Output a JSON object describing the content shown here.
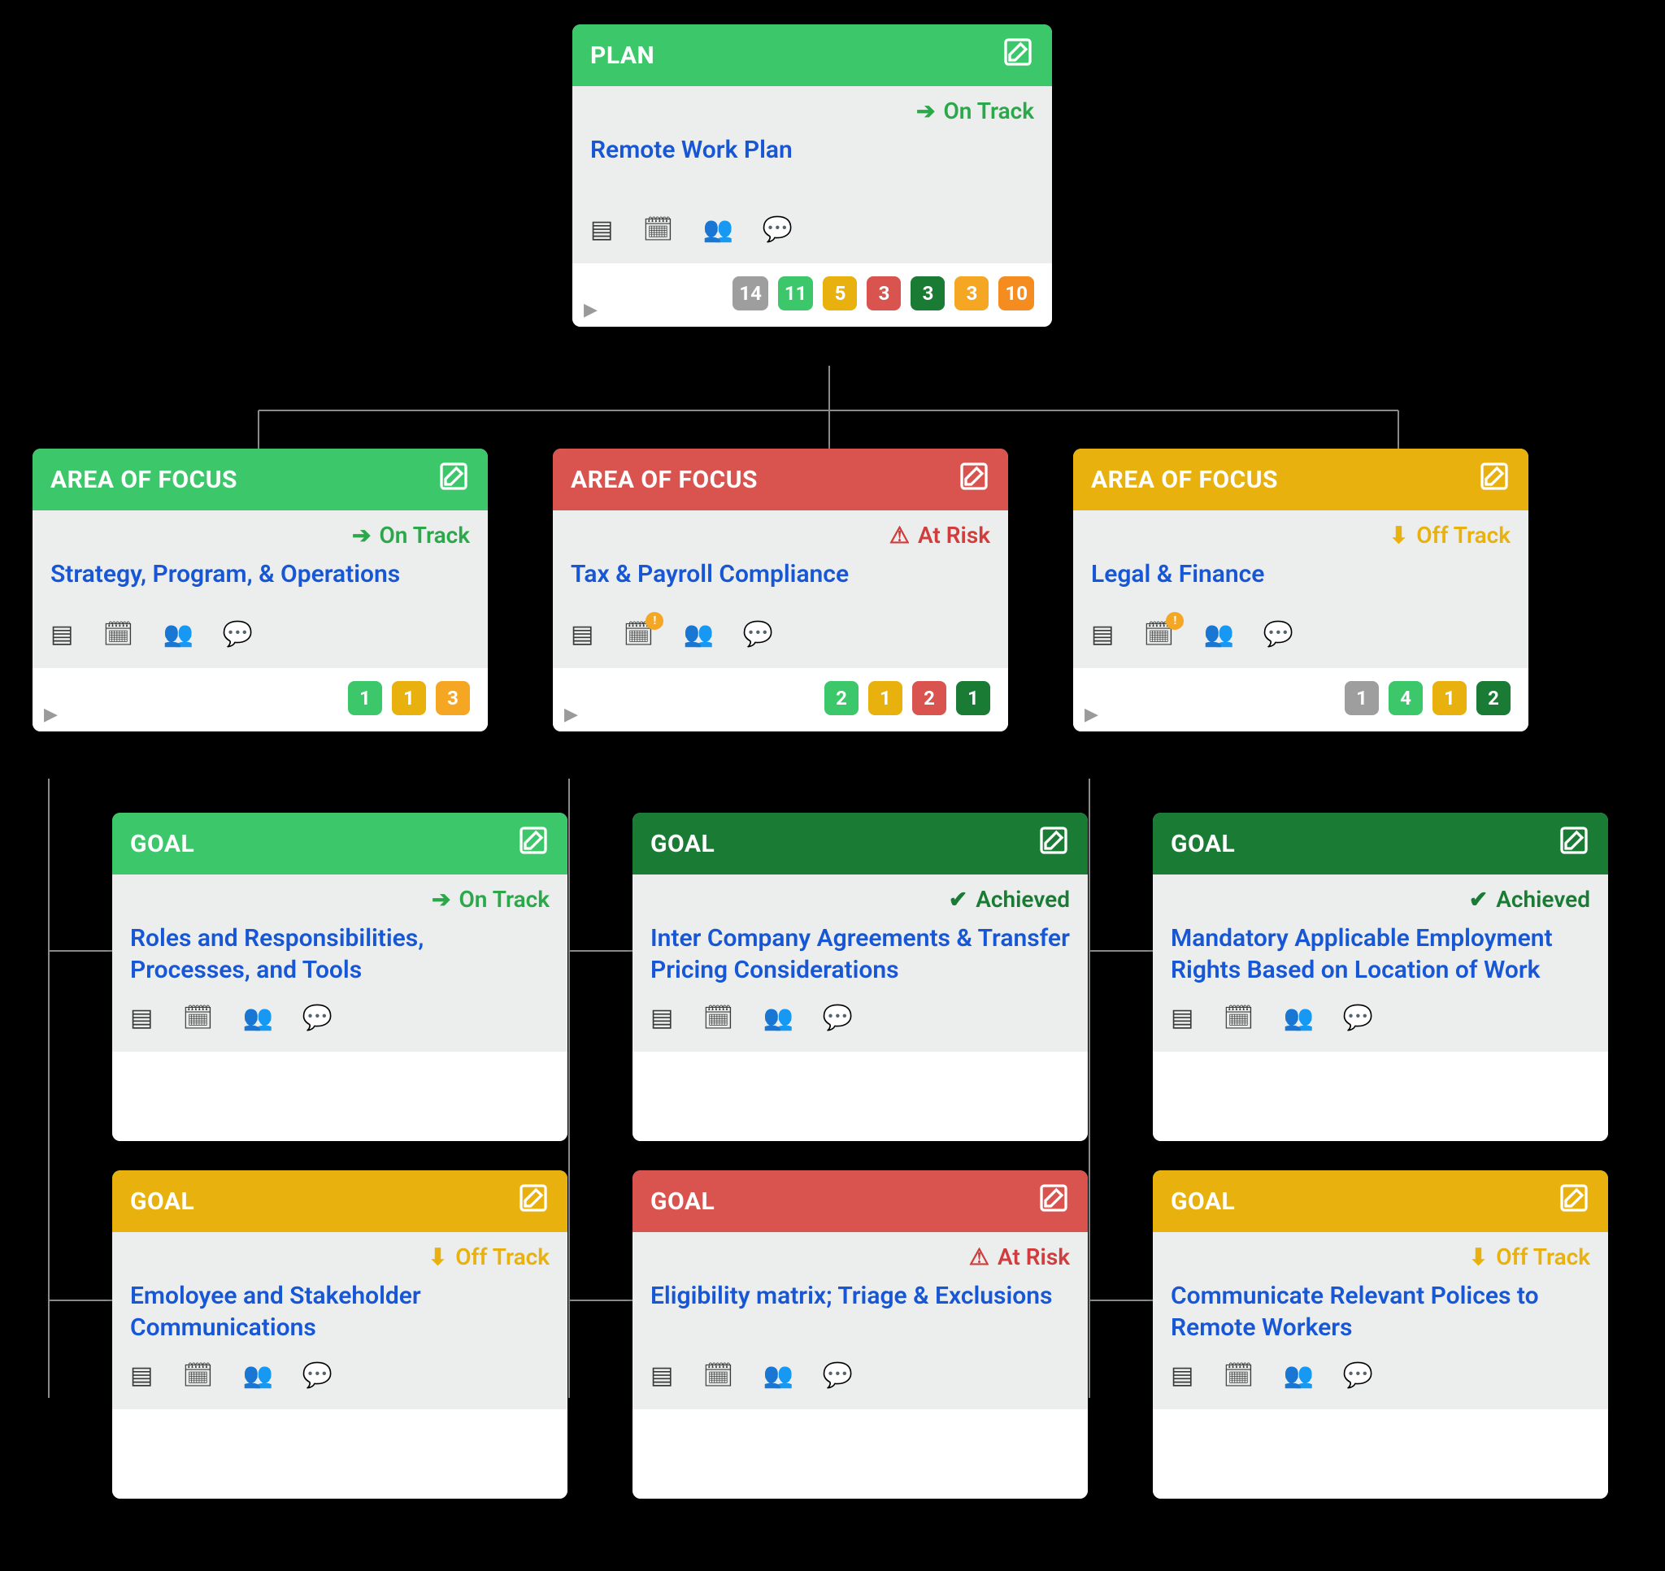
{
  "labels": {
    "plan": "PLAN",
    "area": "AREA OF FOCUS",
    "goal": "GOAL"
  },
  "status": {
    "ontrack": "On Track",
    "atrisk": "At Risk",
    "offtrack": "Off Track",
    "achieved": "Achieved"
  },
  "colors": {
    "green_light": "#3CC76B",
    "green_dark": "#1A7B34",
    "red": "#D9534F",
    "yellow": "#E8B10E",
    "orange": "#F5A623",
    "gray": "#9E9E9E",
    "blue_link": "#1757D6"
  },
  "icons": {
    "server": "server-icon",
    "calendar": "calendar-icon",
    "group": "group-icon",
    "chat": "chat-icon",
    "edit": "edit-icon"
  },
  "plan": {
    "title": "Remote Work Plan",
    "status": "ontrack",
    "badges": [
      {
        "count": 14,
        "color": "gray"
      },
      {
        "count": 11,
        "color": "green"
      },
      {
        "count": 5,
        "color": "yellow"
      },
      {
        "count": 3,
        "color": "red"
      },
      {
        "count": 3,
        "color": "dgreen"
      },
      {
        "count": 3,
        "color": "orange"
      },
      {
        "count": 10,
        "color": "dorange"
      }
    ]
  },
  "areas": [
    {
      "title": "Strategy, Program, & Operations",
      "header_color": "green_light",
      "status": "ontrack",
      "calendar_alert": false,
      "badges": [
        {
          "count": 1,
          "color": "green"
        },
        {
          "count": 1,
          "color": "yellow"
        },
        {
          "count": 3,
          "color": "orange"
        }
      ],
      "goals": [
        {
          "title": "Roles and Responsibilities, Processes, and Tools",
          "header_color": "green_light",
          "status": "ontrack"
        },
        {
          "title": "Emoloyee and Stakeholder Communications",
          "header_color": "yellow",
          "status": "offtrack"
        }
      ]
    },
    {
      "title": "Tax & Payroll Compliance",
      "header_color": "red",
      "status": "atrisk",
      "calendar_alert": true,
      "badges": [
        {
          "count": 2,
          "color": "green"
        },
        {
          "count": 1,
          "color": "yellow"
        },
        {
          "count": 2,
          "color": "red"
        },
        {
          "count": 1,
          "color": "dgreen"
        }
      ],
      "goals": [
        {
          "title": "Inter Company Agreements & Transfer Pricing Considerations",
          "header_color": "green_dark",
          "status": "achieved"
        },
        {
          "title": "Eligibility matrix; Triage & Exclusions",
          "header_color": "red",
          "status": "atrisk"
        }
      ]
    },
    {
      "title": "Legal & Finance",
      "header_color": "yellow",
      "status": "offtrack",
      "calendar_alert": true,
      "badges": [
        {
          "count": 1,
          "color": "gray"
        },
        {
          "count": 4,
          "color": "green"
        },
        {
          "count": 1,
          "color": "yellow"
        },
        {
          "count": 2,
          "color": "dgreen"
        }
      ],
      "goals": [
        {
          "title": "Mandatory Applicable Employment Rights Based on Location of Work",
          "header_color": "green_dark",
          "status": "achieved"
        },
        {
          "title": "Communicate Relevant Polices to Remote Workers",
          "header_color": "yellow",
          "status": "offtrack"
        }
      ]
    }
  ]
}
